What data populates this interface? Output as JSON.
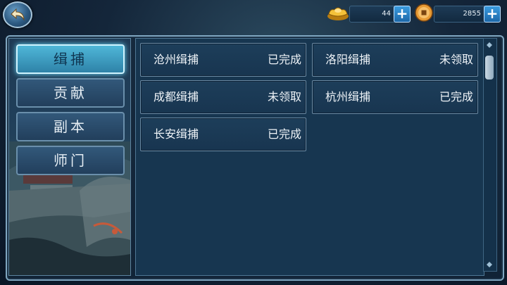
{
  "header": {
    "back_icon": "return-arrow-icon",
    "gold": {
      "icon": "gold-ingot-icon",
      "value": "44",
      "plus": "+"
    },
    "coin": {
      "icon": "copper-coin-icon",
      "value": "2855",
      "plus": "+"
    }
  },
  "tabs": [
    {
      "label": "缉捕",
      "active": true
    },
    {
      "label": "贡献",
      "active": false
    },
    {
      "label": "副本",
      "active": false
    },
    {
      "label": "师门",
      "active": false
    }
  ],
  "cards": [
    {
      "name": "沧州缉捕",
      "status": "已完成"
    },
    {
      "name": "洛阳缉捕",
      "status": "未领取"
    },
    {
      "name": "成都缉捕",
      "status": "未领取"
    },
    {
      "name": "杭州缉捕",
      "status": "已完成"
    },
    {
      "name": "长安缉捕",
      "status": "已完成"
    }
  ]
}
